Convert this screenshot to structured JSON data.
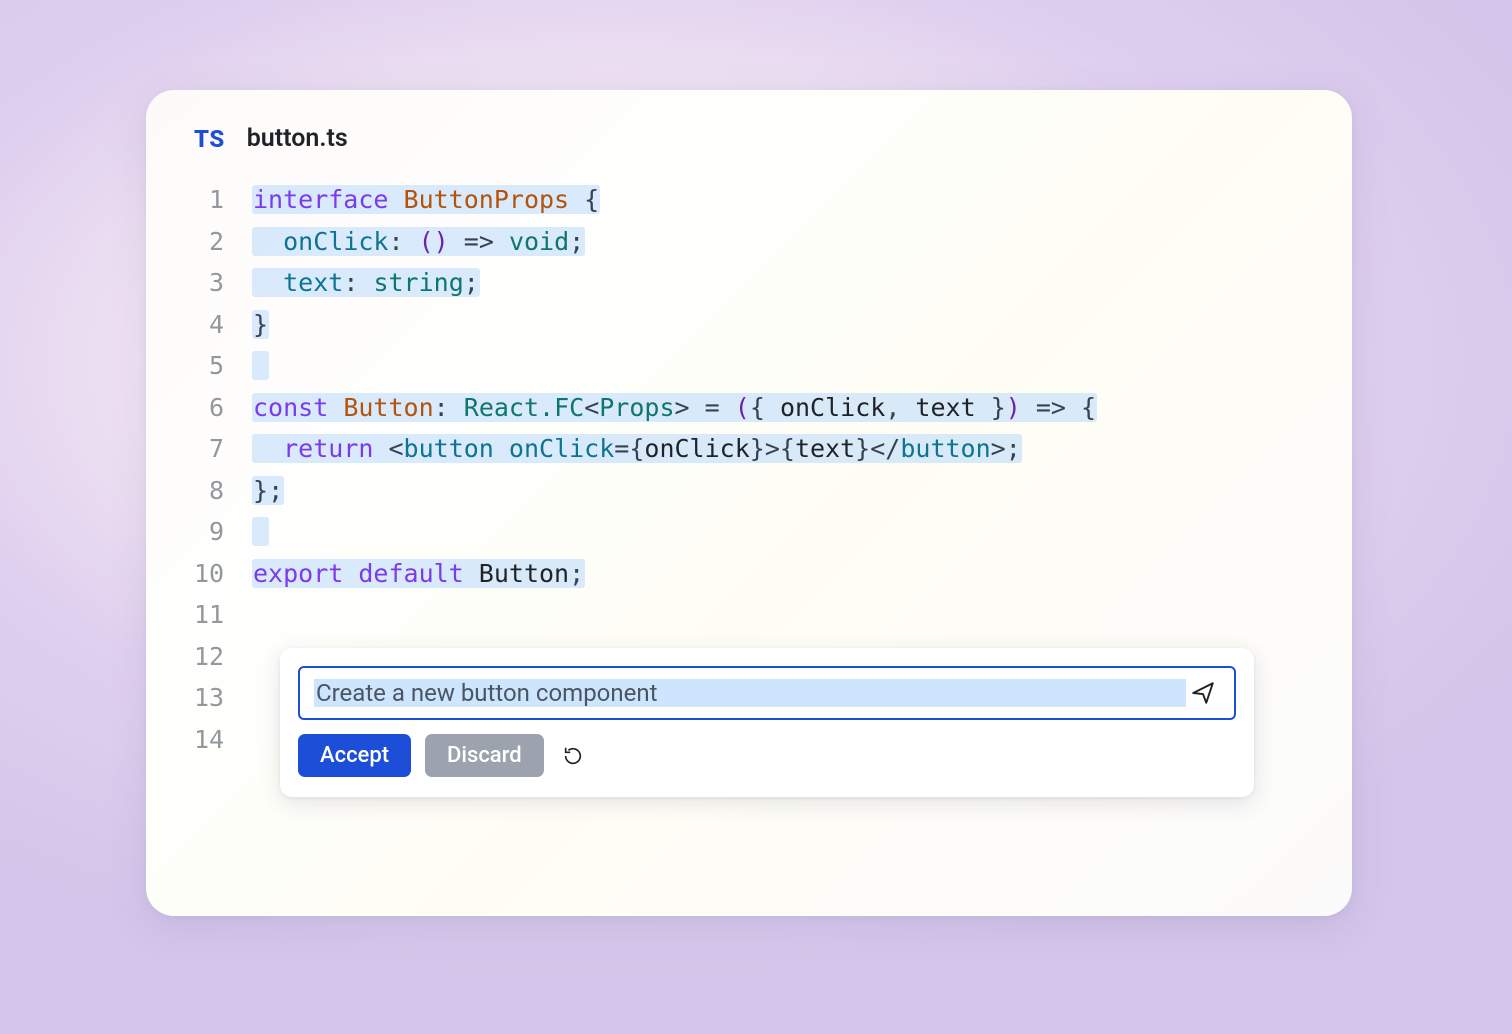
{
  "file": {
    "badge": "TS",
    "name": "button.ts"
  },
  "code": {
    "line_count": 14,
    "lines": [
      {
        "n": 1,
        "highlighted": true,
        "tokens": [
          [
            "kw",
            "interface"
          ],
          [
            "plain",
            " "
          ],
          [
            "type",
            "ButtonProps"
          ],
          [
            "plain",
            " "
          ],
          [
            "punct",
            "{"
          ]
        ]
      },
      {
        "n": 2,
        "highlighted": true,
        "tokens": [
          [
            "plain",
            "  "
          ],
          [
            "prop",
            "onClick"
          ],
          [
            "punct",
            ":"
          ],
          [
            "plain",
            " "
          ],
          [
            "paren",
            "()"
          ],
          [
            "plain",
            " "
          ],
          [
            "op",
            "=>"
          ],
          [
            "plain",
            " "
          ],
          [
            "builtin",
            "void"
          ],
          [
            "punct",
            ";"
          ]
        ]
      },
      {
        "n": 3,
        "highlighted": true,
        "tokens": [
          [
            "plain",
            "  "
          ],
          [
            "prop",
            "text"
          ],
          [
            "punct",
            ":"
          ],
          [
            "plain",
            " "
          ],
          [
            "builtin",
            "string"
          ],
          [
            "punct",
            ";"
          ]
        ]
      },
      {
        "n": 4,
        "highlighted": true,
        "tokens": [
          [
            "punct",
            "}"
          ]
        ]
      },
      {
        "n": 5,
        "highlighted": true,
        "tokens": []
      },
      {
        "n": 6,
        "highlighted": true,
        "tokens": [
          [
            "kw",
            "const"
          ],
          [
            "plain",
            " "
          ],
          [
            "type",
            "Button"
          ],
          [
            "punct",
            ":"
          ],
          [
            "plain",
            " "
          ],
          [
            "builtin",
            "React.FC"
          ],
          [
            "punct",
            "<"
          ],
          [
            "builtin",
            "Props"
          ],
          [
            "punct",
            ">"
          ],
          [
            "plain",
            " "
          ],
          [
            "op",
            "="
          ],
          [
            "plain",
            " "
          ],
          [
            "paren",
            "("
          ],
          [
            "punct",
            "{"
          ],
          [
            "plain",
            " onClick"
          ],
          [
            "punct",
            ","
          ],
          [
            "plain",
            " text "
          ],
          [
            "punct",
            "}"
          ],
          [
            "paren",
            ")"
          ],
          [
            "plain",
            " "
          ],
          [
            "op",
            "=>"
          ],
          [
            "plain",
            " "
          ],
          [
            "punct",
            "{"
          ]
        ]
      },
      {
        "n": 7,
        "highlighted": true,
        "tokens": [
          [
            "plain",
            "  "
          ],
          [
            "kw",
            "return"
          ],
          [
            "plain",
            " "
          ],
          [
            "punct",
            "<"
          ],
          [
            "tag",
            "button"
          ],
          [
            "plain",
            " "
          ],
          [
            "attr",
            "onClick"
          ],
          [
            "op",
            "="
          ],
          [
            "punct",
            "{"
          ],
          [
            "plain",
            "onClick"
          ],
          [
            "punct",
            "}"
          ],
          [
            "punct",
            ">"
          ],
          [
            "punct",
            "{"
          ],
          [
            "plain",
            "text"
          ],
          [
            "punct",
            "}"
          ],
          [
            "punct",
            "</"
          ],
          [
            "tag",
            "button"
          ],
          [
            "punct",
            ">"
          ],
          [
            "punct",
            ";"
          ]
        ]
      },
      {
        "n": 8,
        "highlighted": true,
        "tokens": [
          [
            "punct",
            "}"
          ],
          [
            "punct",
            ";"
          ]
        ]
      },
      {
        "n": 9,
        "highlighted": true,
        "tokens": []
      },
      {
        "n": 10,
        "highlighted": true,
        "tokens": [
          [
            "kw",
            "export"
          ],
          [
            "plain",
            " "
          ],
          [
            "kw",
            "default"
          ],
          [
            "plain",
            " "
          ],
          [
            "plain",
            "Button"
          ],
          [
            "punct",
            ";"
          ]
        ]
      },
      {
        "n": 11,
        "highlighted": false,
        "tokens": []
      },
      {
        "n": 12,
        "highlighted": false,
        "tokens": []
      },
      {
        "n": 13,
        "highlighted": false,
        "tokens": []
      },
      {
        "n": 14,
        "highlighted": false,
        "tokens": []
      }
    ]
  },
  "ai_panel": {
    "input_value": "Create a new button component",
    "accept_label": "Accept",
    "discard_label": "Discard"
  },
  "colors": {
    "keyword": "#7c3aed",
    "type": "#b45309",
    "builtin": "#0f766e",
    "prop": "#0e7490",
    "punct": "#374151",
    "highlight_bg": "rgba(147,197,253,0.35)",
    "accent": "#1d4ed8"
  }
}
